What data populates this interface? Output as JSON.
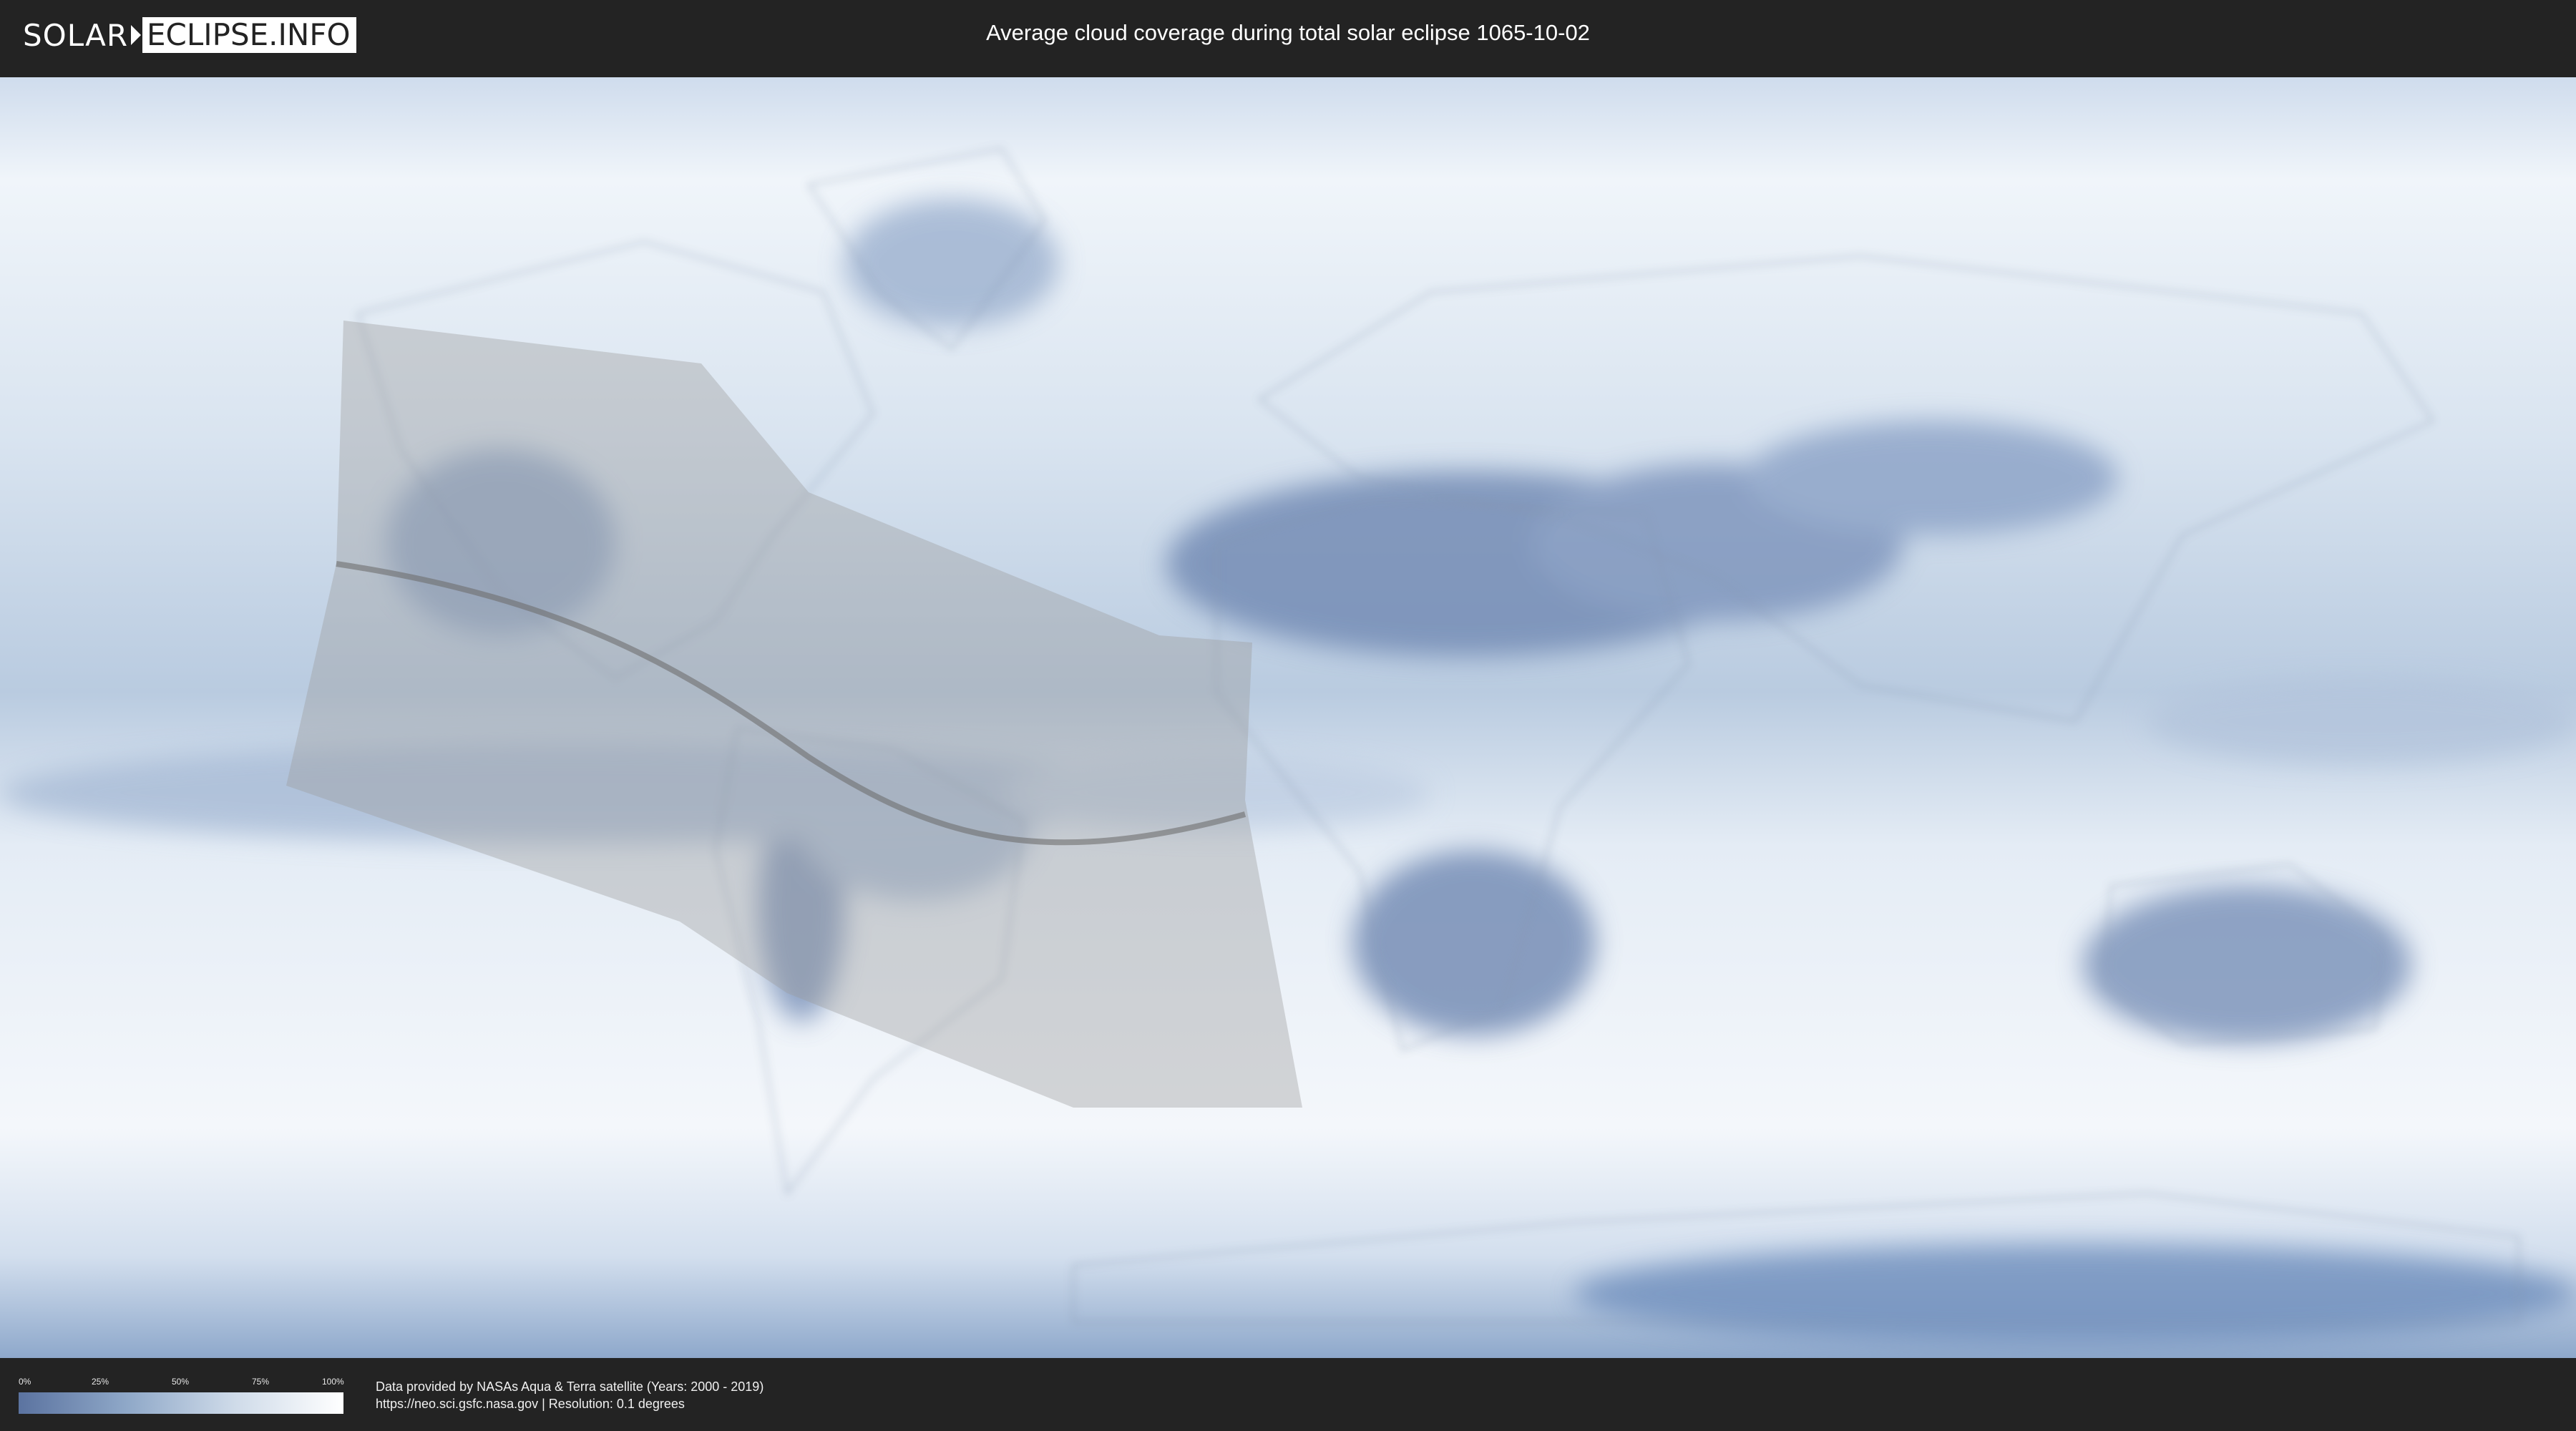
{
  "header": {
    "logo_left": "SOLAR",
    "logo_right": "ECLIPSE.INFO",
    "title": "Average cloud coverage during total solar eclipse 1065-10-02"
  },
  "legend": {
    "ticks": [
      "0%",
      "25%",
      "50%",
      "75%",
      "100%"
    ],
    "colors": {
      "low": "#5b73a0",
      "high": "#ffffff"
    }
  },
  "credits": {
    "line1": "Data provided by NASAs Aqua & Terra satellite (Years: 2000 - 2019)",
    "line2": "https://neo.sci.gsfc.nasa.gov | Resolution: 0.1 degrees"
  },
  "colors": {
    "background": "#232323",
    "ocean_cloud": "#dfe8f2",
    "clear_sky": "#6f88b2",
    "path_shadow": "#9a9a9a"
  }
}
